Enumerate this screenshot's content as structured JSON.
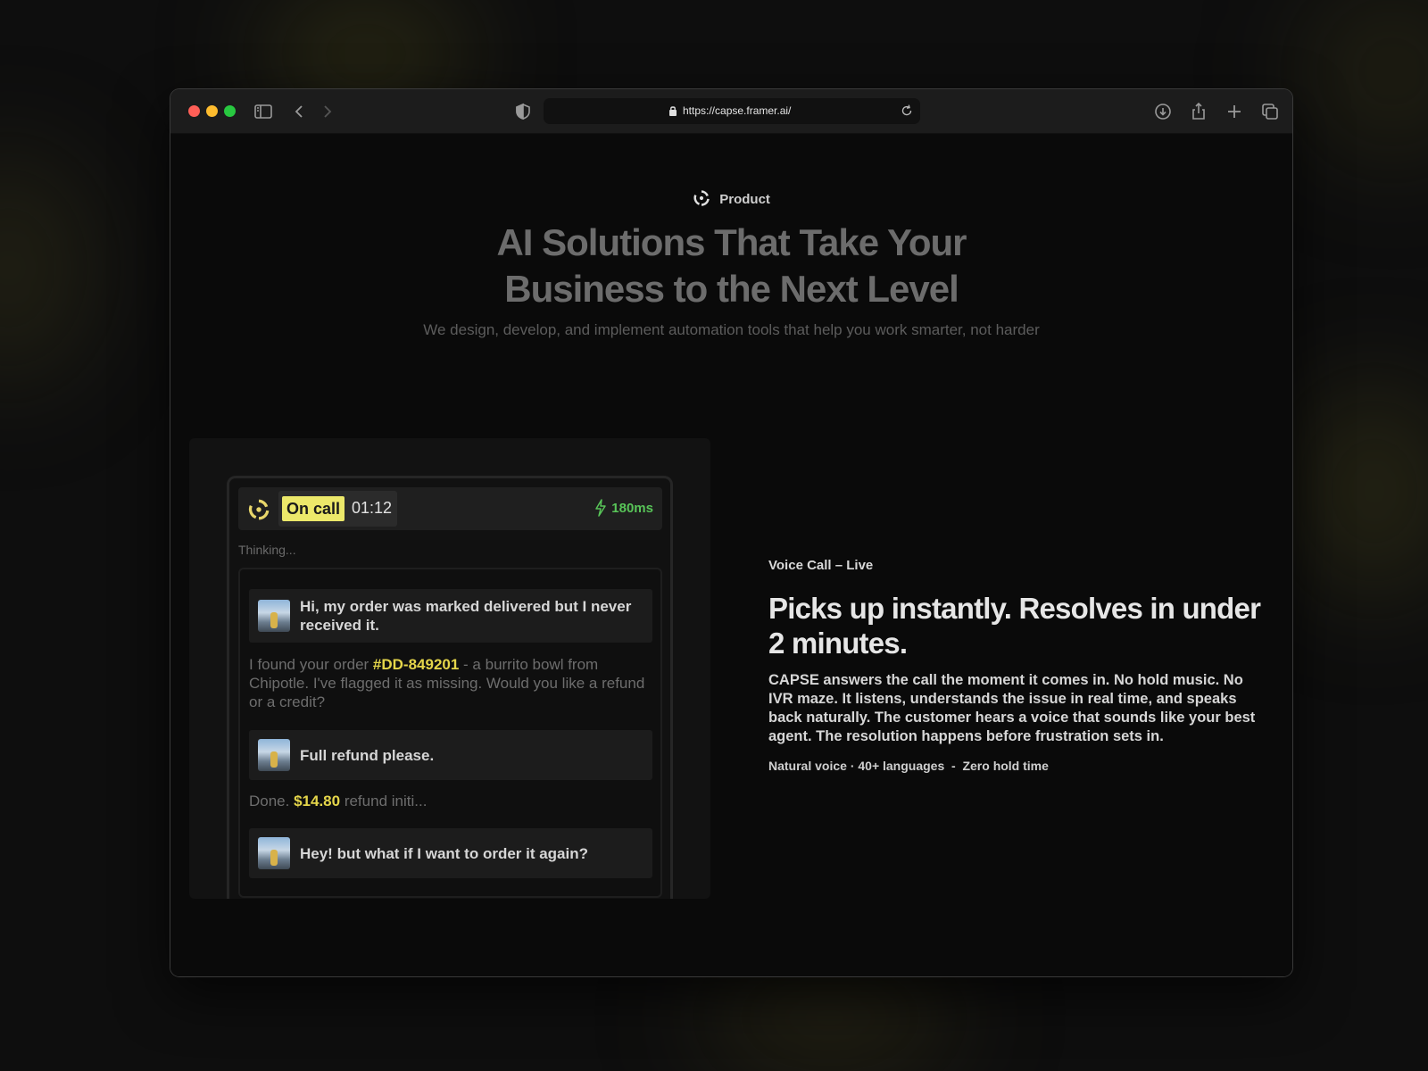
{
  "browser": {
    "url": "https://capse.framer.ai/"
  },
  "hero": {
    "kicker": "Product",
    "title_line1": "AI Solutions That Take Your",
    "title_line2": "Business to the Next Level",
    "subtitle": "We design, develop, and implement automation tools that help you work smarter, not harder"
  },
  "call": {
    "status": "On call",
    "timer": "01:12",
    "latency": "180ms",
    "thinking": "Thinking...",
    "messages": [
      {
        "role": "user",
        "text": "Hi, my order was marked delivered but I never received it."
      },
      {
        "role": "agent",
        "text_before": "I found your order ",
        "highlight": "#DD-849201",
        "text_after": " - a burrito bowl from Chipotle. I've flagged it as missing. Would you like a refund or a credit?"
      },
      {
        "role": "user",
        "text": "Full refund please."
      },
      {
        "role": "agent",
        "text_before": "Done. ",
        "highlight": "$14.80",
        "text_after": " refund initi..."
      },
      {
        "role": "user",
        "text": "Hey! but what if I want to order it again?"
      }
    ]
  },
  "feature": {
    "kicker": "Voice Call – Live",
    "title": "Picks up instantly. Resolves in under 2 minutes.",
    "body": "CAPSE answers the call the moment it comes in. No hold music. No IVR maze. It listens, understands the issue in real time, and speaks back naturally. The customer hears a voice that sounds like your best agent. The resolution happens before frustration sets in.",
    "tags": "Natural voice · 40+ languages  -  Zero hold time"
  },
  "colors": {
    "accent_yellow": "#ece86a",
    "latency_green": "#58c458",
    "background": "#0a0a0a"
  },
  "icons": [
    "sidebar-icon",
    "back-chevron-icon",
    "forward-chevron-icon",
    "shield-icon",
    "lock-icon",
    "reload-icon",
    "download-icon",
    "share-icon",
    "new-tab-icon",
    "tabs-overview-icon",
    "capse-logo-icon",
    "lightning-icon",
    "user-avatar-icon"
  ]
}
